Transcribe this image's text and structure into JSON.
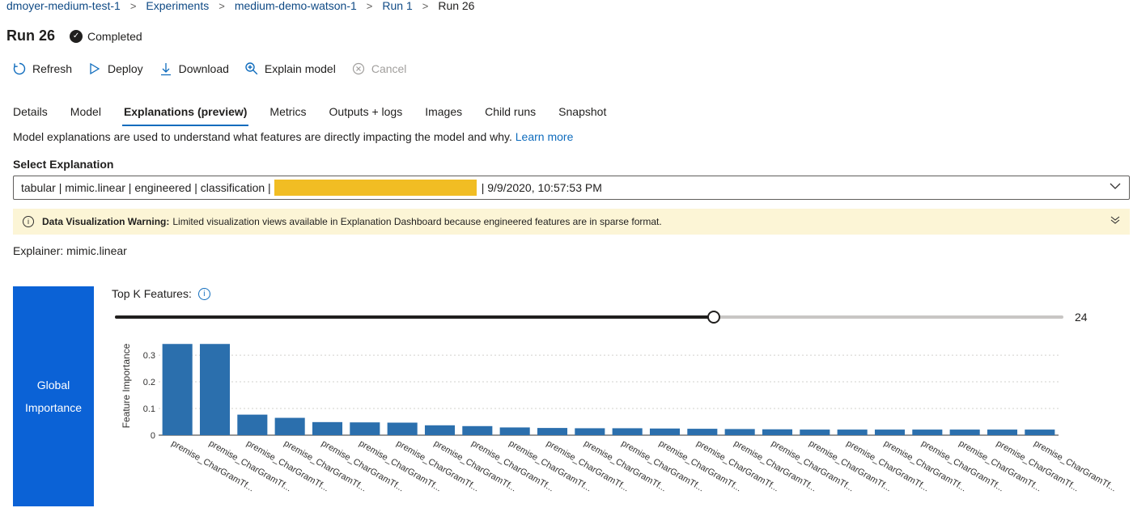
{
  "breadcrumb": [
    "dmoyer-medium-test-1",
    "Experiments",
    "medium-demo-watson-1",
    "Run 1",
    "Run 26"
  ],
  "title": "Run 26",
  "status": "Completed",
  "toolbar": [
    {
      "label": "Refresh",
      "icon": "refresh-icon"
    },
    {
      "label": "Deploy",
      "icon": "deploy-icon"
    },
    {
      "label": "Download",
      "icon": "download-icon"
    },
    {
      "label": "Explain model",
      "icon": "explain-icon"
    },
    {
      "label": "Cancel",
      "icon": "cancel-icon",
      "disabled": true
    }
  ],
  "tabs": [
    "Details",
    "Model",
    "Explanations (preview)",
    "Metrics",
    "Outputs + logs",
    "Images",
    "Child runs",
    "Snapshot"
  ],
  "active_tab": "Explanations (preview)",
  "description": {
    "text": "Model explanations are used to understand what features are directly impacting the model and why.",
    "link": "Learn more"
  },
  "select_explanation": {
    "label": "Select Explanation",
    "prefix": "tabular | mimic.linear | engineered | classification |",
    "suffix": "| 9/9/2020, 10:57:53 PM"
  },
  "warning": {
    "title": "Data Visualization Warning:",
    "text": "Limited visualization views available in Explanation Dashboard because engineered features are in sparse format."
  },
  "explainer": "Explainer: mimic.linear",
  "global_importance": "Global Importance",
  "top_k": {
    "label": "Top K Features:",
    "value": 24,
    "min": 0,
    "max": 38
  },
  "colors": {
    "accent": "#0f6cbd",
    "bar": "#2b6fad",
    "redaction": "#f1bd23",
    "warning_bg": "#fcf5d6",
    "global_btn": "#0b62d6"
  },
  "chart_data": {
    "type": "bar",
    "ylabel": "Feature Importance",
    "xlabel": "",
    "ylim": [
      0,
      0.37
    ],
    "yticks": [
      0,
      0.1,
      0.2,
      0.3
    ],
    "categories": [
      "premise_CharGramTf...",
      "premise_CharGramTf...",
      "premise_CharGramTf...",
      "premise_CharGramTf...",
      "premise_CharGramTf...",
      "premise_CharGramTf...",
      "premise_CharGramTf...",
      "premise_CharGramTf...",
      "premise_CharGramTf...",
      "premise_CharGramTf...",
      "premise_CharGramTf...",
      "premise_CharGramTf...",
      "premise_CharGramTf...",
      "premise_CharGramTf...",
      "premise_CharGramTf...",
      "premise_CharGramTf...",
      "premise_CharGramTf...",
      "premise_CharGramTf...",
      "premise_CharGramTf...",
      "premise_CharGramTf...",
      "premise_CharGramTf...",
      "premise_CharGramTf...",
      "premise_CharGramTf...",
      "premise_CharGramTf..."
    ],
    "values": [
      0.342,
      0.342,
      0.077,
      0.065,
      0.049,
      0.048,
      0.047,
      0.037,
      0.034,
      0.029,
      0.027,
      0.026,
      0.026,
      0.025,
      0.024,
      0.023,
      0.022,
      0.021,
      0.021,
      0.021,
      0.021,
      0.021,
      0.021,
      0.021
    ],
    "grid": true
  }
}
